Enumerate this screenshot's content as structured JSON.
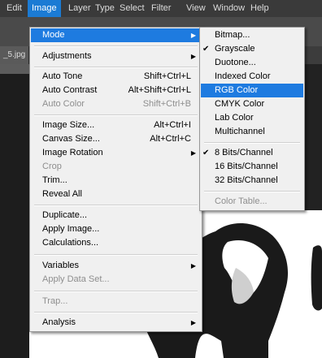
{
  "menubar": {
    "items": [
      "Edit",
      "Image",
      "Layer",
      "Type",
      "Select",
      "Filter",
      "View",
      "Window",
      "Help"
    ],
    "active_index": 1
  },
  "document": {
    "tab_label": "_5.jpg"
  },
  "image_menu": {
    "items": [
      {
        "label": "Mode",
        "submenu": true,
        "highlighted": true
      },
      {
        "label": "Adjustments",
        "submenu": true
      },
      {
        "label": "Auto Tone",
        "shortcut": "Shift+Ctrl+L"
      },
      {
        "label": "Auto Contrast",
        "shortcut": "Alt+Shift+Ctrl+L"
      },
      {
        "label": "Auto Color",
        "shortcut": "Shift+Ctrl+B",
        "disabled": true
      },
      {
        "label": "Image Size...",
        "shortcut": "Alt+Ctrl+I"
      },
      {
        "label": "Canvas Size...",
        "shortcut": "Alt+Ctrl+C"
      },
      {
        "label": "Image Rotation",
        "submenu": true
      },
      {
        "label": "Crop",
        "disabled": true
      },
      {
        "label": "Trim..."
      },
      {
        "label": "Reveal All"
      },
      {
        "label": "Duplicate..."
      },
      {
        "label": "Apply Image..."
      },
      {
        "label": "Calculations..."
      },
      {
        "label": "Variables",
        "submenu": true
      },
      {
        "label": "Apply Data Set...",
        "disabled": true
      },
      {
        "label": "Trap...",
        "disabled": true
      },
      {
        "label": "Analysis",
        "submenu": true
      }
    ]
  },
  "mode_menu": {
    "items": [
      {
        "label": "Bitmap..."
      },
      {
        "label": "Grayscale",
        "checked": true
      },
      {
        "label": "Duotone..."
      },
      {
        "label": "Indexed Color"
      },
      {
        "label": "RGB Color",
        "highlighted": true
      },
      {
        "label": "CMYK Color"
      },
      {
        "label": "Lab Color"
      },
      {
        "label": "Multichannel"
      },
      {
        "label": "8 Bits/Channel",
        "checked": true
      },
      {
        "label": "16 Bits/Channel"
      },
      {
        "label": "32 Bits/Channel"
      },
      {
        "label": "Color Table...",
        "disabled": true
      }
    ]
  },
  "icons": {
    "submenu_arrow": "chevron-right-icon",
    "check": "checkmark-icon"
  },
  "colors": {
    "highlight": "#1e7be0",
    "menu_bg": "#f0f0f0",
    "menubar_bg": "#3a3a3a"
  }
}
